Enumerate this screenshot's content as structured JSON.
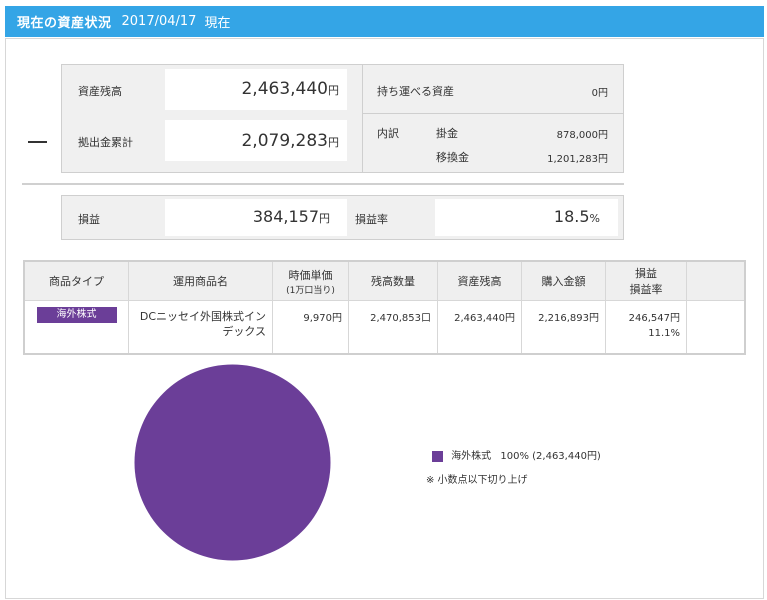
{
  "header": {
    "title": "現在の資産状況",
    "date": "2017/04/17",
    "as_of": "現在"
  },
  "summary": {
    "asset_balance_label": "資産残高",
    "asset_balance_value": "2,463,440",
    "contribution_label": "拠出金累計",
    "contribution_value": "2,079,283",
    "yen": "円",
    "portable_assets_label": "持ち運べる資産",
    "portable_assets_value": "0円",
    "breakdown_label": "内訳",
    "kakekin_label": "掛金",
    "kakekin_value": "878,000円",
    "transfer_label": "移換金",
    "transfer_value": "1,201,283円",
    "collapse_toggle": "—"
  },
  "profit": {
    "profit_label": "損益",
    "profit_value": "384,157",
    "rate_label": "損益率",
    "rate_value": "18.5",
    "percent": "%"
  },
  "table": {
    "headers": {
      "type": "商品タイプ",
      "product": "運用商品名",
      "unit_price": "時価単価",
      "unit_price_sub": "(1万口当り)",
      "quantity": "残高数量",
      "balance": "資産残高",
      "purchase": "購入金額",
      "pl_1": "損益",
      "pl_2": "損益率"
    },
    "rows": [
      {
        "type": "海外株式",
        "product": "DCニッセイ外国株式インデックス",
        "unit_price": "9,970円",
        "quantity": "2,470,853口",
        "balance": "2,463,440円",
        "purchase": "2,216,893円",
        "pl": "246,547円",
        "pl_rate": "11.1%"
      }
    ]
  },
  "chart_data": {
    "type": "pie",
    "categories": [
      "海外株式"
    ],
    "values": [
      100
    ],
    "colors": [
      "#6b3e98"
    ],
    "legend": [
      {
        "label": "海外株式",
        "detail": "100% (2,463,440円)"
      }
    ],
    "note": "※ 小数点以下切り上げ"
  },
  "colors": {
    "header_bg": "#34a5e6",
    "category_purple": "#6b3e98",
    "link_blue": "#1a5aa5"
  }
}
